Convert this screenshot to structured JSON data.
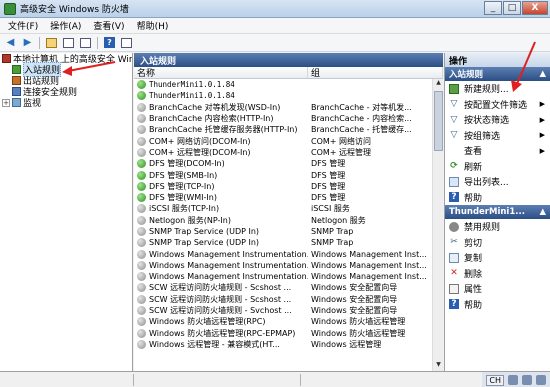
{
  "window": {
    "title": "高级安全 Windows 防火墙",
    "controls": [
      "_",
      "□",
      "X"
    ]
  },
  "menu": [
    "文件(F)",
    "操作(A)",
    "查看(V)",
    "帮助(H)"
  ],
  "tree": {
    "root": "本地计算机 上的高级安全 Windows",
    "items": [
      {
        "label": "入站规则",
        "selected": true
      },
      {
        "label": "出站规则",
        "selected": false
      },
      {
        "label": "连接安全规则",
        "selected": false
      },
      {
        "label": "监视",
        "selected": false
      }
    ]
  },
  "center": {
    "title": "入站规则",
    "columns": [
      "名称",
      "组"
    ],
    "rows": [
      {
        "name": "ThunderMini1.0.1.84",
        "group": "",
        "enabled": true,
        "mono": true
      },
      {
        "name": "ThunderMini1.0.1.84",
        "group": "",
        "enabled": true,
        "mono": true
      },
      {
        "name": "BranchCache 对等机发现(WSD-In)",
        "group": "BranchCache - 对等机发...",
        "enabled": false
      },
      {
        "name": "BranchCache 内容检索(HTTP-In)",
        "group": "BranchCache - 内容检索...",
        "enabled": false
      },
      {
        "name": "BranchCache 托管缓存服务器(HTTP-In)",
        "group": "BranchCache - 托管缓存...",
        "enabled": false
      },
      {
        "name": "COM+ 网络访问(DCOM-In)",
        "group": "COM+ 网络访问",
        "enabled": false
      },
      {
        "name": "COM+ 远程管理(DCOM-In)",
        "group": "COM+ 远程管理",
        "enabled": false
      },
      {
        "name": "DFS 管理(DCOM-In)",
        "group": "DFS 管理",
        "enabled": true
      },
      {
        "name": "DFS 管理(SMB-In)",
        "group": "DFS 管理",
        "enabled": true
      },
      {
        "name": "DFS 管理(TCP-In)",
        "group": "DFS 管理",
        "enabled": true
      },
      {
        "name": "DFS 管理(WMI-In)",
        "group": "DFS 管理",
        "enabled": true
      },
      {
        "name": "iSCSI 服务(TCP-In)",
        "group": "iSCSI 服务",
        "enabled": false
      },
      {
        "name": "Netlogon 服务(NP-In)",
        "group": "Netlogon 服务",
        "enabled": false
      },
      {
        "name": "SNMP Trap Service (UDP In)",
        "group": "SNMP Trap",
        "enabled": false
      },
      {
        "name": "SNMP Trap Service (UDP In)",
        "group": "SNMP Trap",
        "enabled": false
      },
      {
        "name": "Windows Management Instrumentation...",
        "group": "Windows Management Inst...",
        "enabled": false
      },
      {
        "name": "Windows Management Instrumentation...",
        "group": "Windows Management Inst...",
        "enabled": false
      },
      {
        "name": "Windows Management Instrumentation...",
        "group": "Windows Management Inst...",
        "enabled": false
      },
      {
        "name": "SCW 远程访问防火墙规则 - Scshost ...",
        "group": "Windows 安全配置向导",
        "enabled": false
      },
      {
        "name": "SCW 远程访问防火墙规则 - Scshost ...",
        "group": "Windows 安全配置向导",
        "enabled": false
      },
      {
        "name": "SCW 远程访问防火墙规则 - Svchost ...",
        "group": "Windows 安全配置向导",
        "enabled": false
      },
      {
        "name": "Windows 防火墙远程管理(RPC)",
        "group": "Windows 防火墙远程管理",
        "enabled": false
      },
      {
        "name": "Windows 防火墙远程管理(RPC-EPMAP)",
        "group": "Windows 防火墙远程管理",
        "enabled": false
      },
      {
        "name": "Windows 远程管理 - 兼容模式(HT...",
        "group": "Windows 远程管理",
        "enabled": false
      }
    ]
  },
  "actions": {
    "title": "操作",
    "section1": "入站规则",
    "section1_items": [
      {
        "label": "新建规则...",
        "icon": "new-rule-icon",
        "sub": false
      },
      {
        "label": "按配置文件筛选",
        "icon": "filter-icon",
        "sub": true
      },
      {
        "label": "按状态筛选",
        "icon": "filter-icon",
        "sub": true
      },
      {
        "label": "按组筛选",
        "icon": "filter-icon",
        "sub": true
      },
      {
        "label": "查看",
        "icon": "",
        "sub": true
      },
      {
        "label": "刷新",
        "icon": "refresh-icon",
        "sub": false
      },
      {
        "label": "导出列表...",
        "icon": "export-icon",
        "sub": false
      },
      {
        "label": "帮助",
        "icon": "help-icon",
        "sub": false
      }
    ],
    "section2": "ThunderMini1...",
    "section2_items": [
      {
        "label": "禁用规则",
        "icon": "disable-icon"
      },
      {
        "label": "剪切",
        "icon": "cut-icon"
      },
      {
        "label": "复制",
        "icon": "copy-icon"
      },
      {
        "label": "删除",
        "icon": "delete-icon"
      },
      {
        "label": "属性",
        "icon": "properties-icon"
      },
      {
        "label": "帮助",
        "icon": "help-icon"
      }
    ]
  },
  "status": {
    "tray": [
      "CH"
    ]
  },
  "colors": {
    "header_blue": "#2b4e84",
    "enabled_green": "#2e8f1f",
    "annotation_red": "#e02020"
  }
}
